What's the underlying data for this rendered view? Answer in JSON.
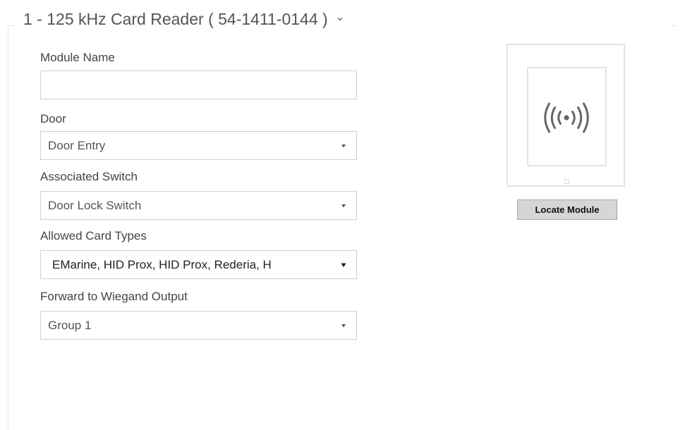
{
  "section": {
    "title": "1 - 125 kHz Card Reader ( 54-1411-0144 )"
  },
  "form": {
    "module_name": {
      "label": "Module Name",
      "value": ""
    },
    "door": {
      "label": "Door",
      "value": "Door Entry"
    },
    "associated_switch": {
      "label": "Associated Switch",
      "value": "Door Lock Switch"
    },
    "allowed_card_types": {
      "label": "Allowed Card Types",
      "value": "EMarine, HID Prox, HID Prox, Rederia, H"
    },
    "forward_wiegand": {
      "label": "Forward to Wiegand Output",
      "value": "Group 1"
    }
  },
  "module_preview": {
    "icon": "rfid-wave-icon",
    "locate_button_label": "Locate Module"
  }
}
